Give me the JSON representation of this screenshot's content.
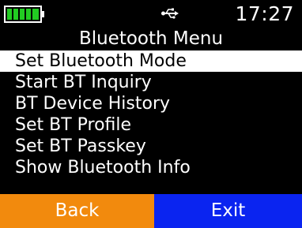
{
  "status_bar": {
    "battery_icon": "battery-full-icon",
    "battery_level": 1.0,
    "usb_icon": "usb-icon",
    "time": "17:27"
  },
  "menu": {
    "title": "Bluetooth Menu",
    "items": [
      {
        "label": "Set Bluetooth Mode",
        "selected": true
      },
      {
        "label": "Start BT Inquiry",
        "selected": false
      },
      {
        "label": "BT Device History",
        "selected": false
      },
      {
        "label": "Set BT Profile",
        "selected": false
      },
      {
        "label": "Set BT Passkey",
        "selected": false
      },
      {
        "label": "Show Bluetooth Info",
        "selected": false
      }
    ]
  },
  "soft_keys": {
    "back_label": "Back",
    "exit_label": "Exit"
  },
  "colors": {
    "background": "#000000",
    "battery": "#22cc22",
    "back_key": "#f28a0d",
    "exit_key": "#0a24f0",
    "selection": "#ffffff"
  }
}
